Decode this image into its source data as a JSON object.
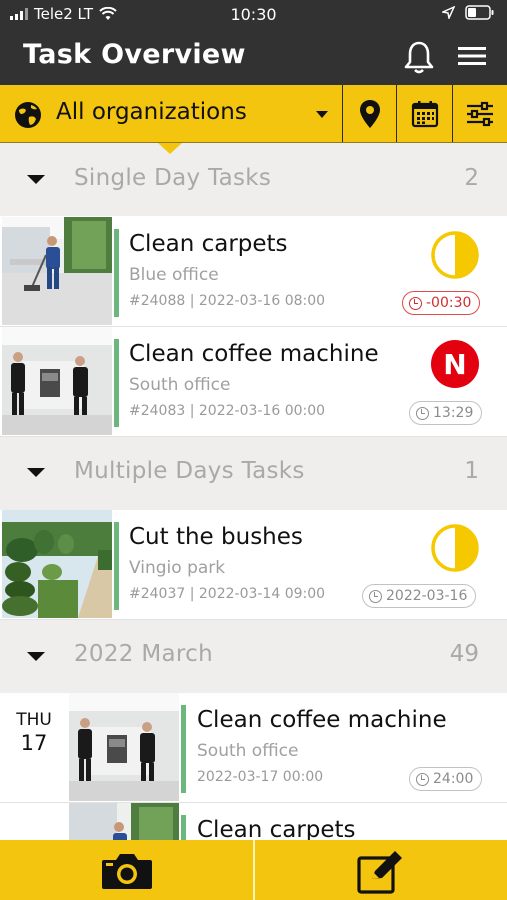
{
  "status_bar": {
    "carrier": "Tele2 LT",
    "time": "10:30"
  },
  "header": {
    "title": "Task Overview",
    "icons": [
      "bell-icon",
      "menu-icon"
    ]
  },
  "filter": {
    "organization": "All organizations",
    "icons": [
      "globe-icon",
      "location-pin-icon",
      "calendar-icon",
      "sliders-icon"
    ]
  },
  "sections": [
    {
      "title": "Single Day Tasks",
      "count": "2"
    },
    {
      "title": "Multiple Days Tasks",
      "count": "1"
    },
    {
      "title": "2022 March",
      "count": "49"
    }
  ],
  "tasks": [
    {
      "title": "Clean carpets",
      "location": "Blue office",
      "meta": "#24088 | 2022-03-16 08:00",
      "time": "-00:30",
      "status": "half-done",
      "status_color": "#f5c800"
    },
    {
      "title": "Clean coffee machine",
      "location": "South office",
      "meta": "#24083 | 2022-03-16 00:00",
      "time": "13:29",
      "status": "new",
      "status_label": "N",
      "status_color": "#e3000f"
    },
    {
      "title": "Cut the bushes",
      "location": "Vingio park",
      "meta": "#24037 | 2022-03-14 09:00",
      "time": "2022-03-16",
      "status": "half-done",
      "status_color": "#f5c800"
    },
    {
      "title": "Clean coffee machine",
      "location": "South office",
      "meta": "2022-03-17 00:00",
      "time": "24:00",
      "day_name": "THU",
      "day_number": "17"
    },
    {
      "title": "Clean carpets"
    }
  ],
  "colors": {
    "accent": "#f4c50f",
    "header": "#323232",
    "task_bar": "#6bb77d",
    "overdue": "#d12f2f"
  },
  "bottom_bar": {
    "icons": [
      "camera-icon",
      "edit-icon"
    ]
  }
}
